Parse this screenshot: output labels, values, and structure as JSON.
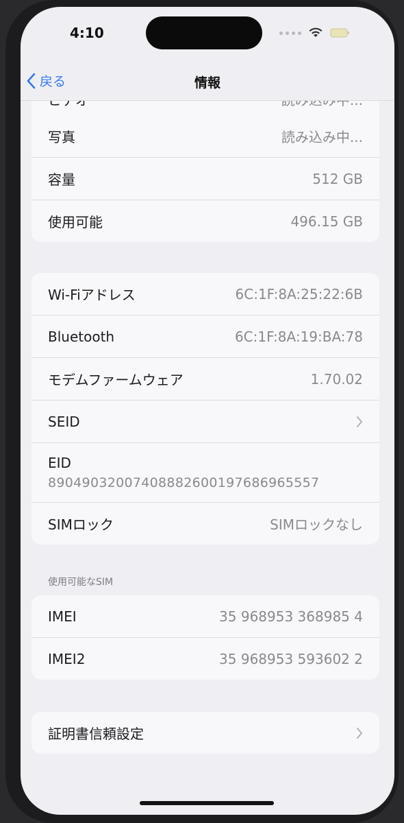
{
  "status_bar": {
    "time": "4:10"
  },
  "nav": {
    "back_label": "戻る",
    "title": "情報"
  },
  "storage": {
    "partial_row": {
      "label": "ビデオ",
      "value": "読み込み中..."
    },
    "rows": [
      {
        "label": "写真",
        "value": "読み込み中..."
      },
      {
        "label": "容量",
        "value": "512 GB"
      },
      {
        "label": "使用可能",
        "value": "496.15 GB"
      }
    ]
  },
  "network": {
    "wifi": {
      "label": "Wi-Fiアドレス",
      "value": "6C:1F:8A:25:22:6B"
    },
    "bluetooth": {
      "label": "Bluetooth",
      "value": "6C:1F:8A:19:BA:78"
    },
    "modem": {
      "label": "モデムファームウェア",
      "value": "1.70.02"
    },
    "seid": {
      "label": "SEID"
    },
    "eid": {
      "label": "EID",
      "value": "89049032007408882600197686965557"
    },
    "simlock": {
      "label": "SIMロック",
      "value": "SIMロックなし"
    }
  },
  "sim_section": {
    "header": "使用可能なSIM",
    "imei": {
      "label": "IMEI",
      "value": "35 968953 368985 4"
    },
    "imei2": {
      "label": "IMEI2",
      "value": "35 968953 593602 2"
    }
  },
  "certificate": {
    "label": "証明書信頼設定"
  },
  "icons": {
    "back": "chevron-left-icon",
    "wifi": "wifi-icon",
    "battery": "battery-icon",
    "disclosure": "chevron-right-icon"
  },
  "colors": {
    "accent": "#3478f6",
    "background": "#efeff3",
    "cell": "#f8f8fa"
  }
}
